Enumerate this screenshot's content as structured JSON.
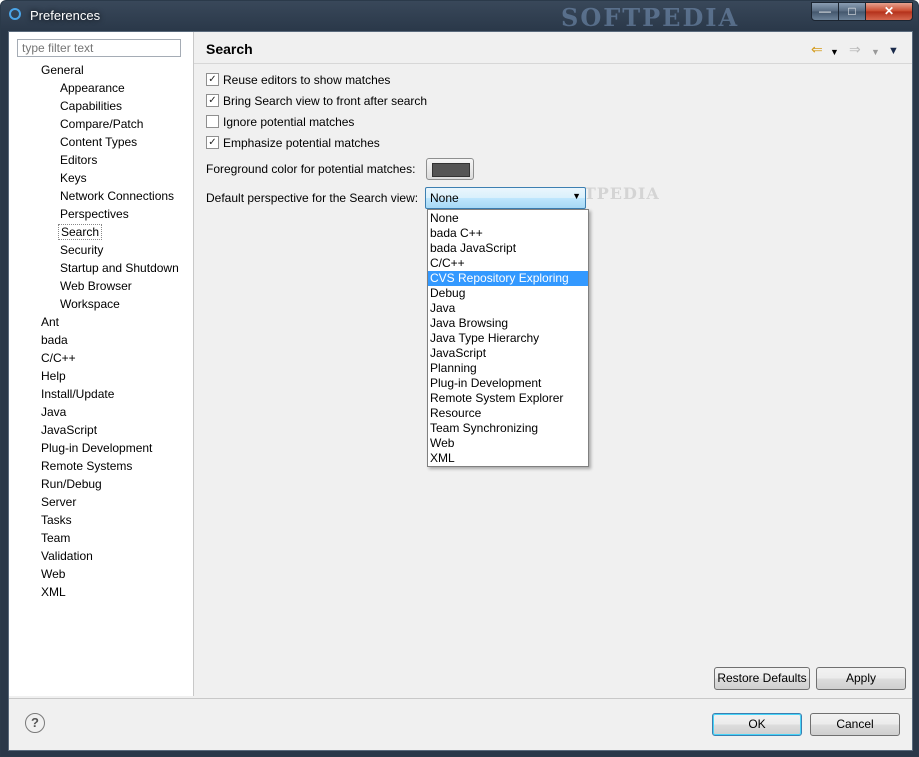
{
  "window": {
    "title": "Preferences",
    "watermark": "SOFTPEDIA"
  },
  "filter": {
    "placeholder": "type filter text"
  },
  "tree": [
    {
      "label": "General",
      "level": 0
    },
    {
      "label": "Appearance",
      "level": 1
    },
    {
      "label": "Capabilities",
      "level": 1
    },
    {
      "label": "Compare/Patch",
      "level": 1
    },
    {
      "label": "Content Types",
      "level": 1
    },
    {
      "label": "Editors",
      "level": 1
    },
    {
      "label": "Keys",
      "level": 1
    },
    {
      "label": "Network Connections",
      "level": 1
    },
    {
      "label": "Perspectives",
      "level": 1
    },
    {
      "label": "Search",
      "level": 1,
      "selected": true
    },
    {
      "label": "Security",
      "level": 1
    },
    {
      "label": "Startup and Shutdown",
      "level": 1
    },
    {
      "label": "Web Browser",
      "level": 1
    },
    {
      "label": "Workspace",
      "level": 1
    },
    {
      "label": "Ant",
      "level": 0
    },
    {
      "label": "bada",
      "level": 0
    },
    {
      "label": "C/C++",
      "level": 0
    },
    {
      "label": "Help",
      "level": 0
    },
    {
      "label": "Install/Update",
      "level": 0
    },
    {
      "label": "Java",
      "level": 0
    },
    {
      "label": "JavaScript",
      "level": 0
    },
    {
      "label": "Plug-in Development",
      "level": 0
    },
    {
      "label": "Remote Systems",
      "level": 0
    },
    {
      "label": "Run/Debug",
      "level": 0
    },
    {
      "label": "Server",
      "level": 0
    },
    {
      "label": "Tasks",
      "level": 0
    },
    {
      "label": "Team",
      "level": 0
    },
    {
      "label": "Validation",
      "level": 0
    },
    {
      "label": "Web",
      "level": 0
    },
    {
      "label": "XML",
      "level": 0
    }
  ],
  "page": {
    "title": "Search",
    "checkboxes": [
      {
        "label": "Reuse editors to show matches",
        "checked": true
      },
      {
        "label": "Bring Search view to front after search",
        "checked": true
      },
      {
        "label": "Ignore potential matches",
        "checked": false
      },
      {
        "label": "Emphasize potential matches",
        "checked": true
      }
    ],
    "fg_color_label": "Foreground color for potential matches:",
    "fg_color": "#555555",
    "perspective_label": "Default perspective for the Search view:",
    "perspective_value": "None",
    "watermark": "SOFTPEDIA",
    "perspective_options": [
      "None",
      "bada C++",
      "bada JavaScript",
      "C/C++",
      "CVS Repository Exploring",
      "Debug",
      "Java",
      "Java Browsing",
      "Java Type Hierarchy",
      "JavaScript",
      "Planning",
      "Plug-in Development",
      "Remote System Explorer",
      "Resource",
      "Team Synchronizing",
      "Web",
      "XML"
    ],
    "highlighted_option": "CVS Repository Exploring"
  },
  "buttons": {
    "restore_defaults": "Restore Defaults",
    "apply": "Apply",
    "ok": "OK",
    "cancel": "Cancel",
    "help": "?"
  },
  "nav_icons": [
    "back-icon",
    "back-menu-icon",
    "forward-icon",
    "forward-menu-icon",
    "view-menu-icon"
  ]
}
